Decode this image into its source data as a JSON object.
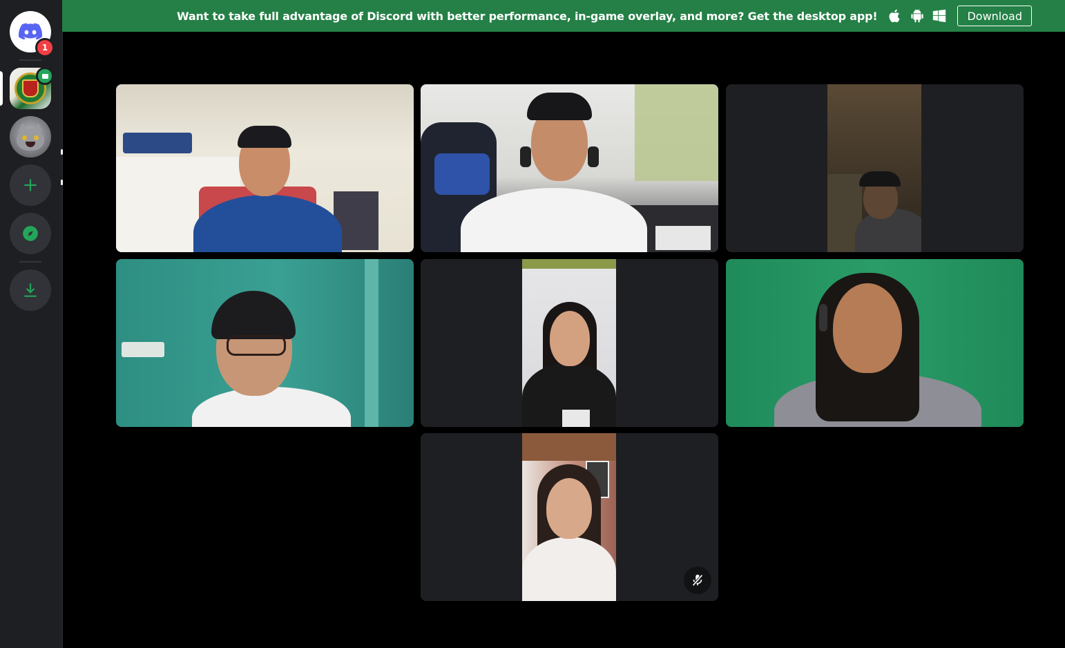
{
  "banner": {
    "text": "Want to take full advantage of Discord with better performance, in-game overlay, and more? Get the desktop app!",
    "download_label": "Download",
    "color": "#248046"
  },
  "sidebar": {
    "home_badge": "1",
    "icons": [
      "discord-home-icon",
      "university-server-icon",
      "cat-server-icon",
      "add-server-icon",
      "explore-icon",
      "download-apps-icon"
    ]
  },
  "call": {
    "tiles": [
      {
        "name": "participant-1",
        "camera": "on"
      },
      {
        "name": "participant-2",
        "camera": "on"
      },
      {
        "name": "participant-3",
        "camera": "on"
      },
      {
        "name": "participant-4",
        "camera": "on"
      },
      {
        "name": "participant-5",
        "camera": "on"
      },
      {
        "name": "participant-6",
        "camera": "on"
      },
      {
        "name": "participant-7",
        "camera": "on",
        "muted": true
      }
    ]
  },
  "colors": {
    "accent_green": "#23a55a",
    "badge_red": "#f23f43",
    "tile_bg": "#1e1f22",
    "sidebar_bg": "#1e1f22"
  }
}
